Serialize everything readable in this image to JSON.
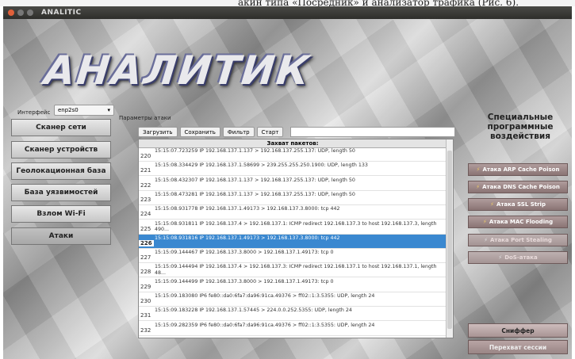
{
  "caption_top": "акин типа «Посредник» и анализатор трафика (Рис. 6).",
  "window": {
    "title": "ANALITIC",
    "logo": "АНАЛИТИК"
  },
  "interface": {
    "label": "Интерфейс",
    "value": "enp2s0"
  },
  "left_nav": [
    {
      "label": "Сканер сети"
    },
    {
      "label": "Сканер устройств"
    },
    {
      "label": "Геолокационная база"
    },
    {
      "label": "База уязвимостей"
    },
    {
      "label": "Взлом Wi-Fi"
    },
    {
      "label": "Атаки",
      "selected": true
    }
  ],
  "attack_params": {
    "label": "Параметры атаки",
    "buttons": {
      "load": "Загрузить",
      "save": "Сохранить",
      "filter": "Фильтр",
      "start": "Старт"
    },
    "capture_header": "Захват пакетов:",
    "packets": [
      {
        "n": "220",
        "text": "15:15:07.723259 IP 192.168.137.1.137 > 192.168.137.255.137: UDP, length 50"
      },
      {
        "n": "221",
        "text": "15:15:08.334429 IP 192.168.137.1.58699 > 239.255.255.250.1900: UDP, length 133"
      },
      {
        "n": "222",
        "text": "15:15:08.432307 IP 192.168.137.1.137 > 192.168.137.255.137: UDP, length 50"
      },
      {
        "n": "223",
        "text": "15:15:08.473281 IP 192.168.137.1.137 > 192.168.137.255.137: UDP, length 50"
      },
      {
        "n": "224",
        "text": "15:15:08.931778 IP 192.168.137.1.49173 > 192.168.137.3.8000: tcp 442"
      },
      {
        "n": "225",
        "text": "15:15:08.931811 IP 192.168.137.4 > 192.168.137.1: ICMP redirect 192.168.137.3 to host 192.168.137.3, length 490..."
      },
      {
        "n": "226",
        "text": "15:15:08.931816 IP 192.168.137.1.49173 > 192.168.137.3.8000: tcp 442",
        "selected": true
      },
      {
        "n": "227",
        "text": "15:15:09.144467 IP 192.168.137.3.8000 > 192.168.137.1.49173: tcp 0"
      },
      {
        "n": "228",
        "text": "15:15:09.144494 IP 192.168.137.4 > 192.168.137.3: ICMP redirect 192.168.137.1 to host 192.168.137.1, length 48..."
      },
      {
        "n": "229",
        "text": "15:15:09.144499 IP 192.168.137.3.8000 > 192.168.137.1.49173: tcp 0"
      },
      {
        "n": "230",
        "text": "15:15:09.183080 IP6 fe80::da0:6fa7:da96:91ca.49376 > ff02::1:3.5355: UDP, length 24"
      },
      {
        "n": "231",
        "text": "15:15:09.183228 IP 192.168.137.1.57445 > 224.0.0.252.5355: UDP, length 24"
      },
      {
        "n": "232",
        "text": "15:15:09.282359 IP6 fe80::da0:6fa7:da96:91ca.49376 > ff02::1:3.5355: UDP, length 24"
      }
    ]
  },
  "special": {
    "title_lines": [
      "Специальные",
      "программные",
      "воздействия"
    ],
    "attacks": [
      {
        "label": "Атака ARP Cache Poison",
        "icon": "wand-icon",
        "enabled": true
      },
      {
        "label": "Атака DNS Cache Poison",
        "icon": "wand-icon",
        "enabled": true
      },
      {
        "label": "Атака SSL Strip",
        "icon": "wand-icon",
        "enabled": true
      },
      {
        "label": "Атака MAC Flooding",
        "icon": "wand-icon",
        "enabled": true
      },
      {
        "label": "Атака Port Stealing",
        "icon": "wand-icon",
        "enabled": false
      },
      {
        "label": "DoS-атака",
        "icon": "wand-icon",
        "enabled": false
      }
    ],
    "sniffer": "Сниффер",
    "session_hijack": "Перехват сессии"
  }
}
